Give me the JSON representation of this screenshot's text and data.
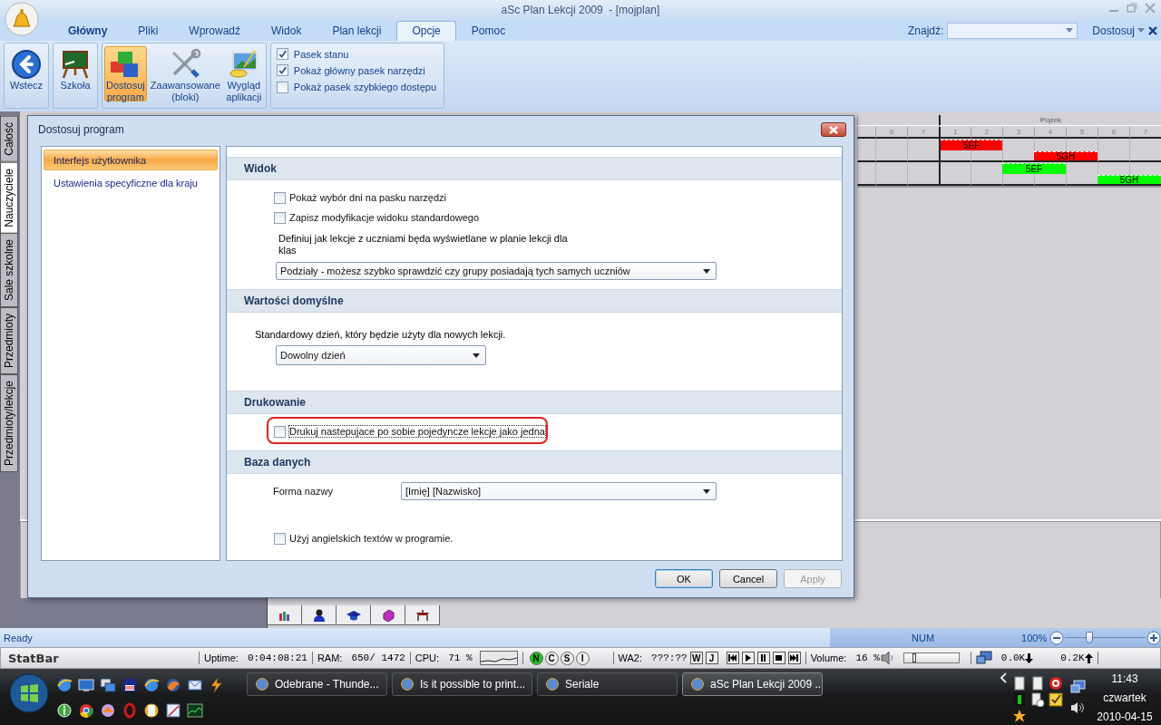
{
  "window": {
    "title": "aSc Plan Lekcji 2009  - [mojplan]"
  },
  "ribbon_tabs": [
    {
      "label": "Główny",
      "kind": "main",
      "selected": false
    },
    {
      "label": "Pliki",
      "kind": "tab",
      "selected": false
    },
    {
      "label": "Wprowadź",
      "kind": "tab",
      "selected": false
    },
    {
      "label": "Widok",
      "kind": "tab",
      "selected": false
    },
    {
      "label": "Plan lekcji",
      "kind": "tab",
      "selected": false
    },
    {
      "label": "Opcje",
      "kind": "tab",
      "selected": true
    },
    {
      "label": "Pomoc",
      "kind": "tab",
      "selected": false
    }
  ],
  "find": {
    "label": "Znajdź:"
  },
  "customize_menu": {
    "label": "Dostosuj"
  },
  "ribbon_groups": [
    {
      "buttons": [
        {
          "kind": "back",
          "lines": [
            "Wstecz"
          ],
          "selected": false
        }
      ]
    },
    {
      "buttons": [
        {
          "kind": "school",
          "lines": [
            "Szkoła"
          ],
          "selected": false
        }
      ]
    },
    {
      "buttons": [
        {
          "kind": "blocks",
          "lines": [
            "Dostosuj",
            "program"
          ],
          "selected": true
        },
        {
          "kind": "tools",
          "lines": [
            "Zaawansowane",
            "(bloki)"
          ],
          "selected": false
        },
        {
          "kind": "paint",
          "lines": [
            "Wygląd",
            "aplikacji"
          ],
          "selected": false
        }
      ]
    }
  ],
  "ribbon_checks": [
    {
      "label": "Pasek stanu",
      "checked": true
    },
    {
      "label": "Pokaż główny pasek narzędzi",
      "checked": true
    },
    {
      "label": "Pokaż pasek szybkiego dostępu",
      "checked": false
    }
  ],
  "side_tabs": [
    {
      "label": "Całość",
      "selected": false
    },
    {
      "label": "Nauczyciele",
      "selected": true
    },
    {
      "label": "Sale szkolne",
      "selected": false
    },
    {
      "label": "Przedmioty",
      "selected": false
    },
    {
      "label": "Przedmioty/lekcje",
      "selected": false
    }
  ],
  "timetable": {
    "day": "Piątek",
    "periods": [
      "6",
      "7",
      "1",
      "2",
      "3",
      "4",
      "5",
      "6",
      "7"
    ],
    "rows": [
      {
        "lanes": [
          [
            {
              "kind": "empty"
            },
            {
              "kind": "empty"
            },
            {
              "kind": "lesson",
              "label": "5EF",
              "color": "#ff0000"
            },
            {
              "kind": "empty"
            },
            {
              "kind": "empty"
            },
            {
              "kind": "empty"
            },
            {
              "kind": "empty"
            },
            {
              "kind": "empty"
            }
          ],
          [
            {
              "kind": "empty"
            },
            {
              "kind": "empty"
            },
            {
              "kind": "empty"
            },
            {
              "kind": "empty"
            },
            {
              "kind": "empty"
            },
            {
              "kind": "lesson",
              "label": "5GH",
              "color": "#ff0000"
            },
            {
              "kind": "empty"
            },
            {
              "kind": "empty"
            }
          ]
        ]
      },
      {
        "lanes": [
          [
            {
              "kind": "empty"
            },
            {
              "kind": "empty"
            },
            {
              "kind": "empty"
            },
            {
              "kind": "empty"
            },
            {
              "kind": "lesson",
              "label": "5EF",
              "color": "#00ff00"
            },
            {
              "kind": "empty"
            },
            {
              "kind": "empty"
            },
            {
              "kind": "empty"
            }
          ],
          [
            {
              "kind": "empty"
            },
            {
              "kind": "empty"
            },
            {
              "kind": "empty"
            },
            {
              "kind": "empty"
            },
            {
              "kind": "empty"
            },
            {
              "kind": "empty"
            },
            {
              "kind": "empty"
            },
            {
              "kind": "lesson",
              "label": "5GH",
              "color": "#00ff00"
            }
          ]
        ]
      }
    ]
  },
  "dialog": {
    "title": "Dostosuj program",
    "nav": [
      {
        "label": "Interfejs użytkownika",
        "selected": true
      },
      {
        "label": "Ustawienia specyficzne dla kraju",
        "selected": false
      }
    ],
    "sections": [
      {
        "title": "Widok",
        "items": [
          {
            "kind": "checkbox",
            "label": "Pokaż wybór dni na pasku narzędzi",
            "checked": false,
            "highlighted": false
          },
          {
            "kind": "checkbox",
            "label": "Zapisz modyfikacje widoku standardowego",
            "checked": false,
            "highlighted": false
          },
          {
            "kind": "caption",
            "text": "Definiuj jak lekcje z uczniami będa wyświetlane w planie lekcji dla klas"
          },
          {
            "kind": "dropdown",
            "value": "Podziały - możesz szybko sprawdzić czy grupy posiadają tych samych uczniów"
          }
        ]
      },
      {
        "title": "Wartości domyślne",
        "items": [
          {
            "kind": "note",
            "text": "Standardowy dzień, który będzie użyty dla nowych lekcji."
          },
          {
            "kind": "short-dropdown",
            "value": "Dowolny dzień"
          }
        ]
      },
      {
        "title": "Drukowanie",
        "items": [
          {
            "kind": "checkbox",
            "label": "Drukuj nastepujace po sobie pojedyncze lekcje jako jedna",
            "checked": false,
            "highlighted": true
          }
        ]
      },
      {
        "title": "Baza danych",
        "items": [
          {
            "kind": "labeled-dropdown",
            "label": "Forma nazwy",
            "value": "[Imię]  [Nazwisko]"
          },
          {
            "kind": "checkbox",
            "label": "Użyj angielskich textów w programie.",
            "checked": false,
            "highlighted": false
          }
        ]
      }
    ],
    "buttons": [
      {
        "label": "OK",
        "default": true,
        "disabled": false
      },
      {
        "label": "Cancel",
        "default": false,
        "disabled": false
      },
      {
        "label": "Apply",
        "default": false,
        "disabled": true
      }
    ]
  },
  "status_bar": {
    "text": "Ready",
    "indicator": "NUM",
    "zoom": "100%",
    "zoom_slider": {
      "level": 0.3
    }
  },
  "statbar": {
    "title": "StatBar",
    "uptime_label": "Uptime:",
    "uptime": "0:04:08:21",
    "ram_label": "RAM:",
    "ram": "650/ 1472",
    "cpu_label": "CPU:",
    "cpu": "71 %",
    "toggles": [
      {
        "label": "N",
        "on": true
      },
      {
        "label": "C",
        "on": false
      },
      {
        "label": "S",
        "on": false
      },
      {
        "label": "I",
        "on": false
      }
    ],
    "wa_label": "WA2:",
    "wa_time": "???:??",
    "wa_buttons": [
      "W",
      "J"
    ],
    "volume_label": "Volume:",
    "volume": "16 %",
    "volume_slider": {
      "level": 0.2
    },
    "down": "0.0K",
    "up": "0.2K"
  },
  "taskbar": {
    "tasks": [
      {
        "label": "Odebrane - Thunde...",
        "selected": false
      },
      {
        "label": "Is it possible to print...",
        "selected": false
      },
      {
        "label": "Seriale",
        "selected": false
      },
      {
        "label": "aSc Plan Lekcji 2009 ...",
        "selected": true
      }
    ],
    "clock": {
      "time": "11:43",
      "day": "czwartek",
      "date": "2010-04-15"
    }
  }
}
